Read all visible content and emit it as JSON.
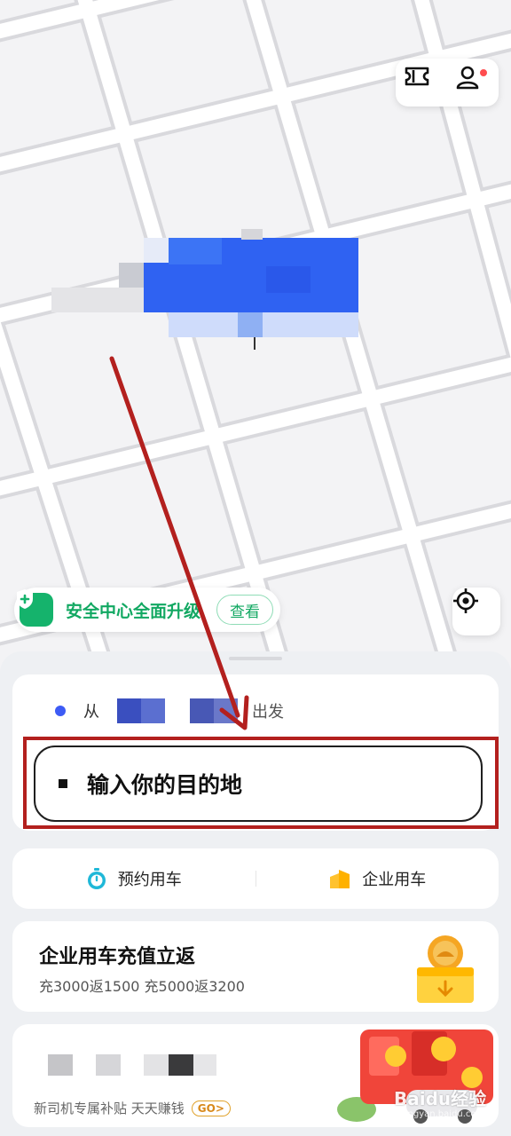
{
  "map": {
    "top_actions": [
      "ticket-icon",
      "user-icon"
    ],
    "safety_banner": {
      "text": "安全中心全面升级",
      "button": "查看"
    },
    "locate_icon": "crosshair-icon"
  },
  "route": {
    "from_prefix": "从",
    "from_suffix": "出发",
    "destination_placeholder": "输入你的目的地"
  },
  "services": [
    {
      "label": "预约用车",
      "icon": "stopwatch-icon"
    },
    {
      "label": "企业用车",
      "icon": "building-icon"
    }
  ],
  "promo": {
    "title": "企业用车充值立返",
    "subtitle": "充3000返1500  充5000返3200"
  },
  "driver_promo": {
    "subtitle": "新司机专属补贴 天天赚钱",
    "badge": "GO>"
  },
  "watermark": {
    "brand": "Baidu经验",
    "url": "jingyan.baidu.com"
  },
  "colors": {
    "accent_green": "#12a862",
    "from_dot": "#3d5bf5",
    "highlight_red": "#b3201e"
  }
}
